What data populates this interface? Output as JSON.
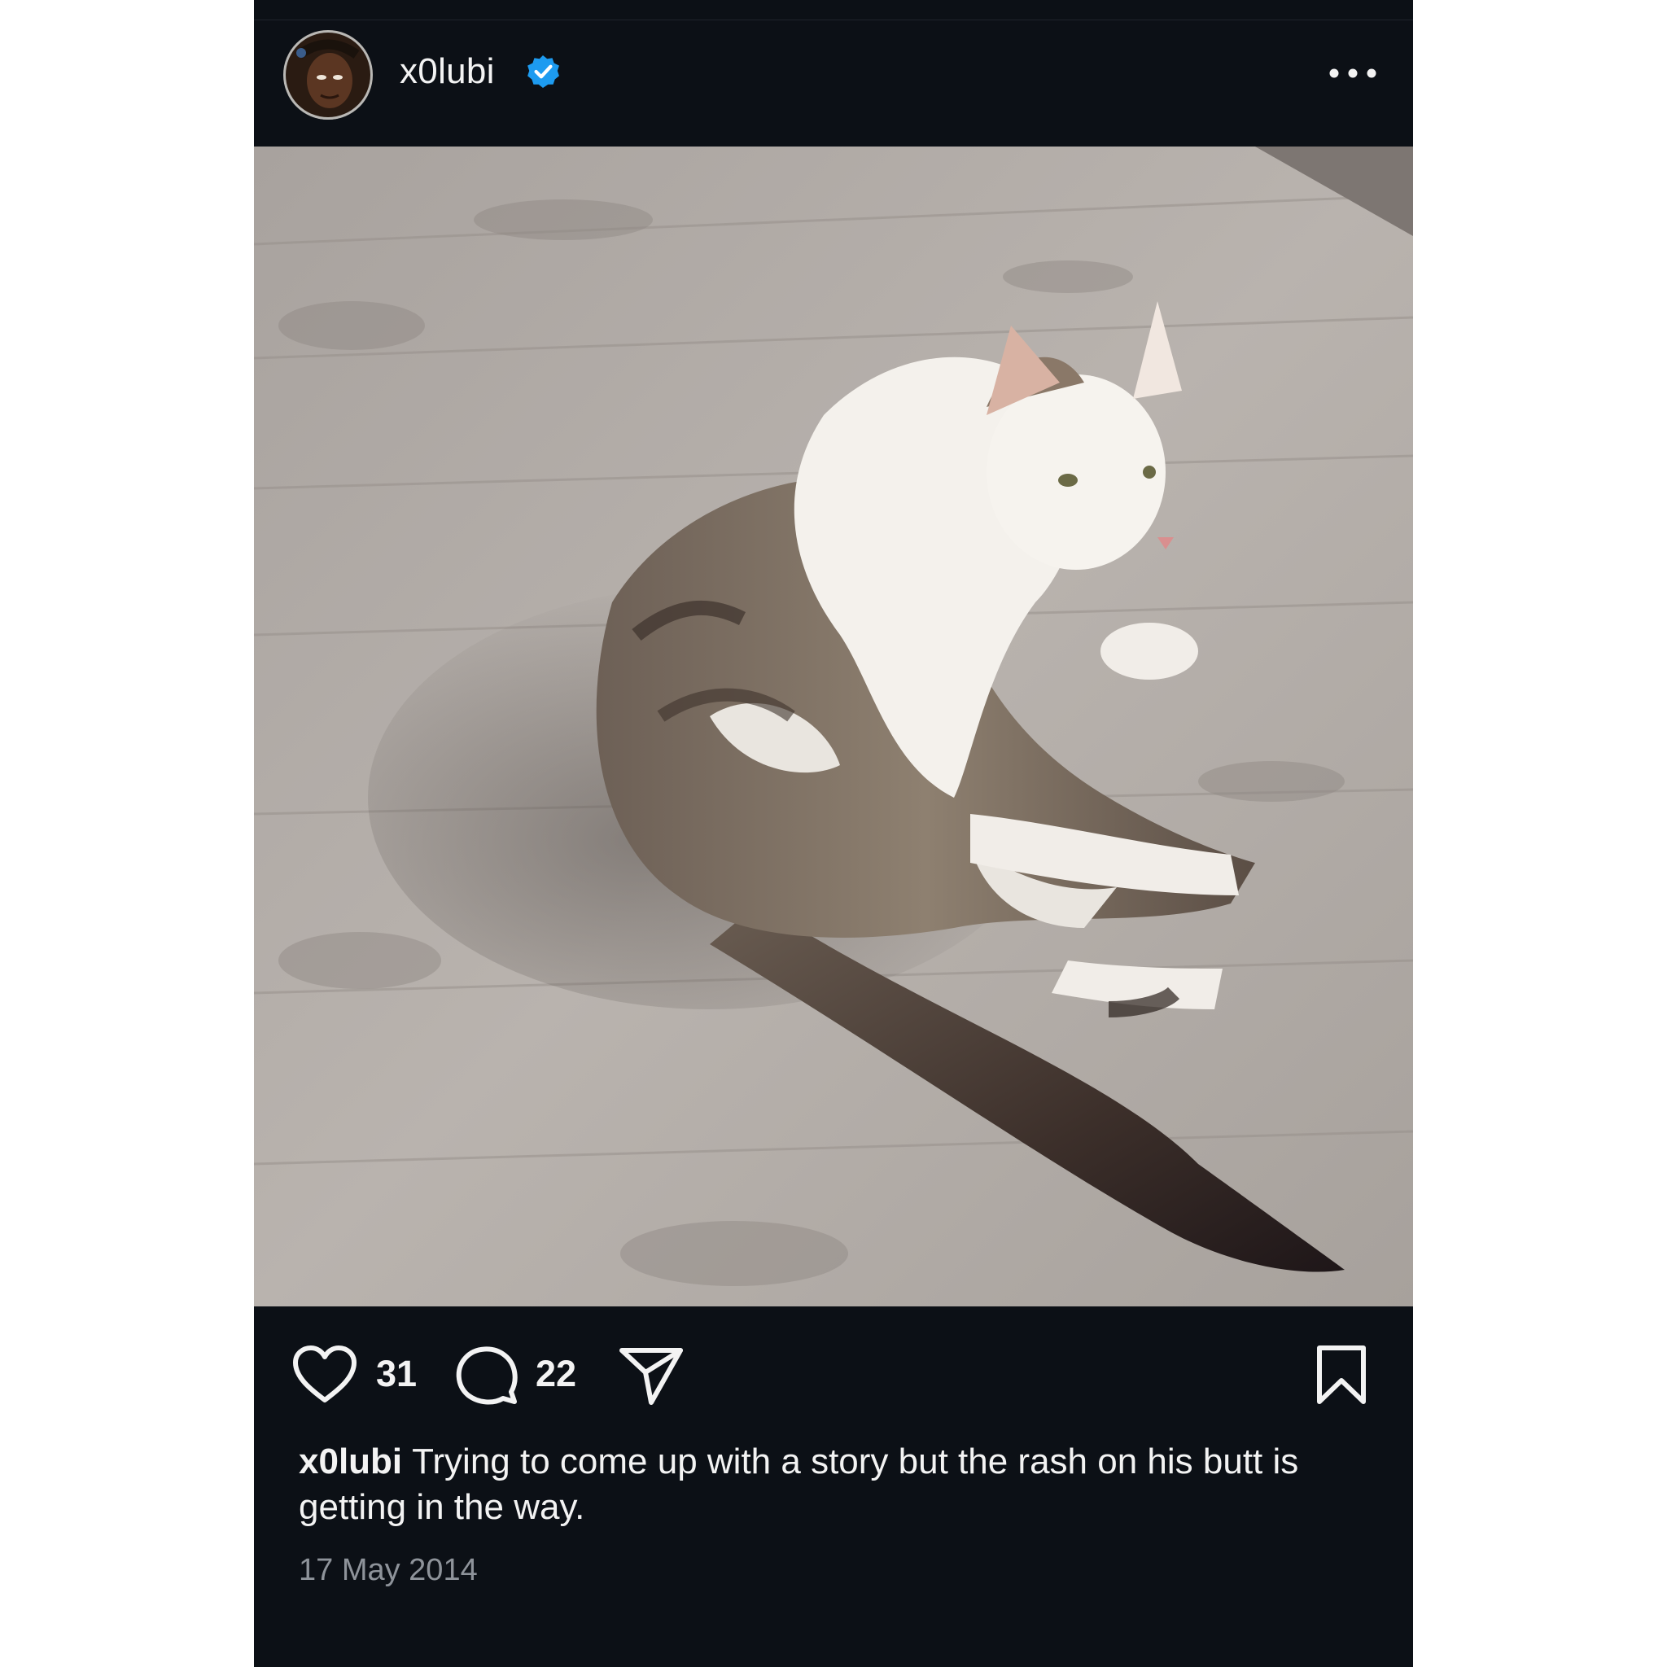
{
  "post": {
    "username": "x0lubi",
    "verified": true,
    "likes": "31",
    "comments": "22",
    "caption_user": "x0lubi",
    "caption_text": "Trying to come up with a story but the rash on his butt is getting in the way.",
    "date": "17 May 2014"
  },
  "icons": {
    "verified": "verified-badge-icon",
    "more": "more-options-icon",
    "like": "heart-icon",
    "comment": "comment-icon",
    "share": "send-icon",
    "save": "bookmark-icon"
  },
  "colors": {
    "background": "#0c1016",
    "text": "#f3f3f3",
    "muted": "#8e939a",
    "verified": "#1d9bf0"
  }
}
